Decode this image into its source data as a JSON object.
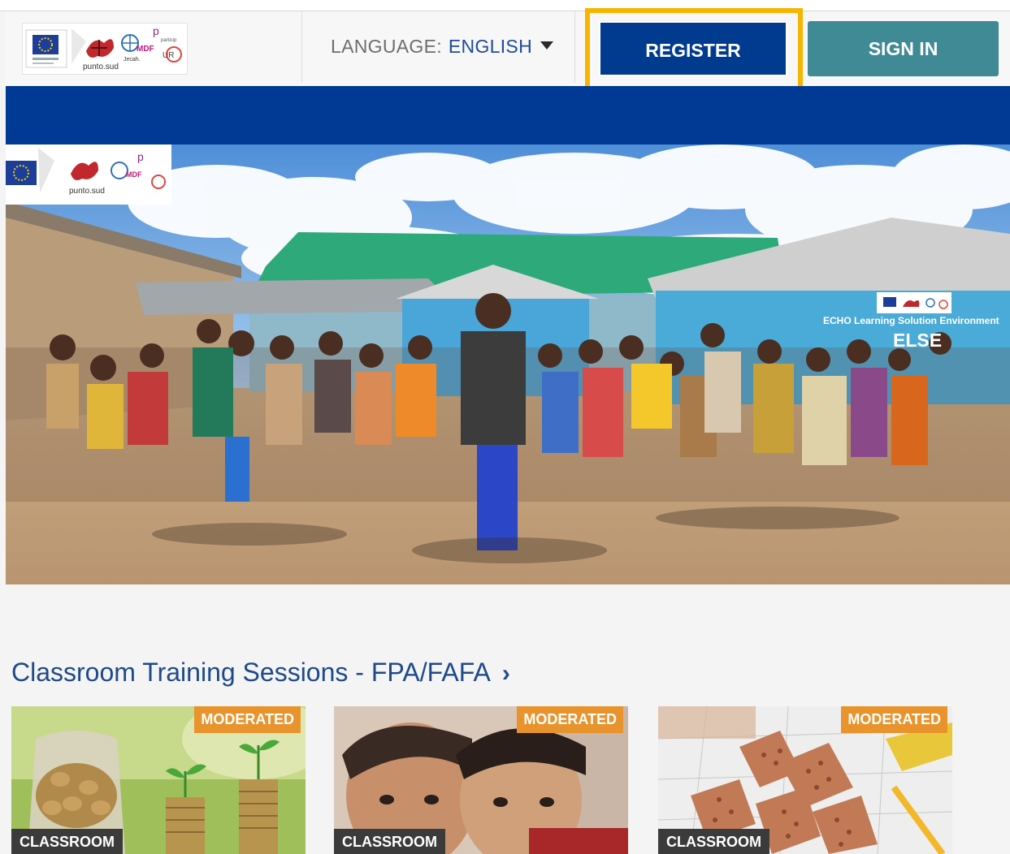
{
  "header": {
    "language_label": "LANGUAGE:",
    "language_value": "ENGLISH",
    "register_label": "REGISTER",
    "signin_label": "SIGN IN"
  },
  "hero": {
    "banner_title": "ECHO Learning Solution Environment",
    "banner_acronym": "ELSE"
  },
  "section": {
    "title": "Classroom Training Sessions - FPA/FAFA",
    "chevron": "›"
  },
  "cards": [
    {
      "badge": "MODERATED",
      "type": "CLASSROOM"
    },
    {
      "badge": "MODERATED",
      "type": "CLASSROOM"
    },
    {
      "badge": "MODERATED",
      "type": "CLASSROOM"
    }
  ],
  "colors": {
    "primary_blue": "#003b8f",
    "signin_teal": "#3f8a94",
    "highlight": "#f7b500",
    "badge_orange": "#e8932b"
  }
}
